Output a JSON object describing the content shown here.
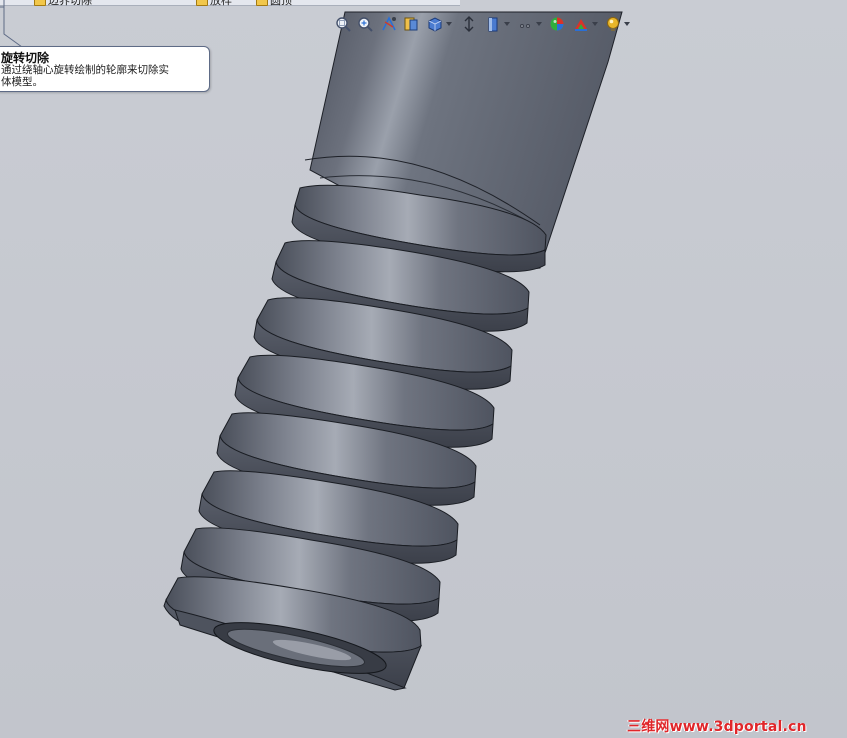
{
  "menu": {
    "items": [
      {
        "label": "边界切除",
        "icon": "folder-icon"
      },
      {
        "label": "放样",
        "icon": "folder-icon"
      },
      {
        "label": "圆顶",
        "icon": "folder-icon"
      }
    ]
  },
  "toolbar": {
    "buttons": [
      {
        "name": "zoom-to-fit-icon"
      },
      {
        "name": "zoom-to-area-icon"
      },
      {
        "name": "previous-view-icon"
      },
      {
        "name": "section-view-icon"
      },
      {
        "name": "view-orientation-icon"
      },
      {
        "name": "display-style-icon"
      },
      {
        "name": "hide-show-items-icon"
      },
      {
        "name": "edit-appearance-icon"
      },
      {
        "name": "apply-scene-icon"
      },
      {
        "name": "view-settings-icon"
      }
    ]
  },
  "tooltip": {
    "title": "旋转切除",
    "line1": "通过绕轴心旋转绘制的轮廓来切除实",
    "line2": "体模型。"
  },
  "watermark": {
    "text": "三维网www.3dportal.cn"
  },
  "colors": {
    "viewport_bg": "#c6c9d0",
    "model_body": "#5f6572",
    "watermark": "#e0262a"
  }
}
